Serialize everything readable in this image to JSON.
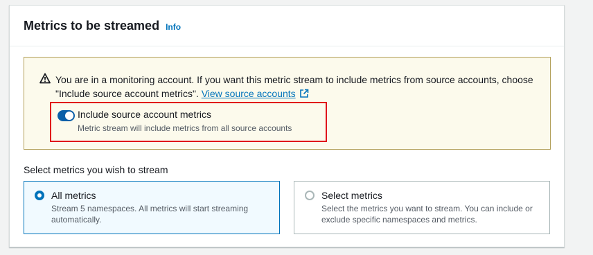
{
  "panel": {
    "title": "Metrics to be streamed",
    "info_label": "Info"
  },
  "alert": {
    "message": "You are in a monitoring account. If you want this metric stream to include metrics from source accounts, choose \"Include source account metrics\".",
    "link_label": "View source accounts",
    "icon": "warning-icon",
    "toggle": {
      "label": "Include source account metrics",
      "description": "Metric stream will include metrics from all source accounts",
      "enabled": true
    }
  },
  "selection": {
    "label": "Select metrics you wish to stream",
    "options": [
      {
        "title": "All metrics",
        "description": "Stream 5 namespaces. All metrics will start streaming automatically.",
        "selected": true
      },
      {
        "title": "Select metrics",
        "description": "Select the metrics you want to stream. You can include or exclude specific namespaces and metrics.",
        "selected": false
      }
    ]
  },
  "colors": {
    "link": "#0073bb",
    "highlight_border": "#e0131a",
    "alert_bg": "#fcfaec",
    "toggle_on": "#0a5fa8"
  }
}
